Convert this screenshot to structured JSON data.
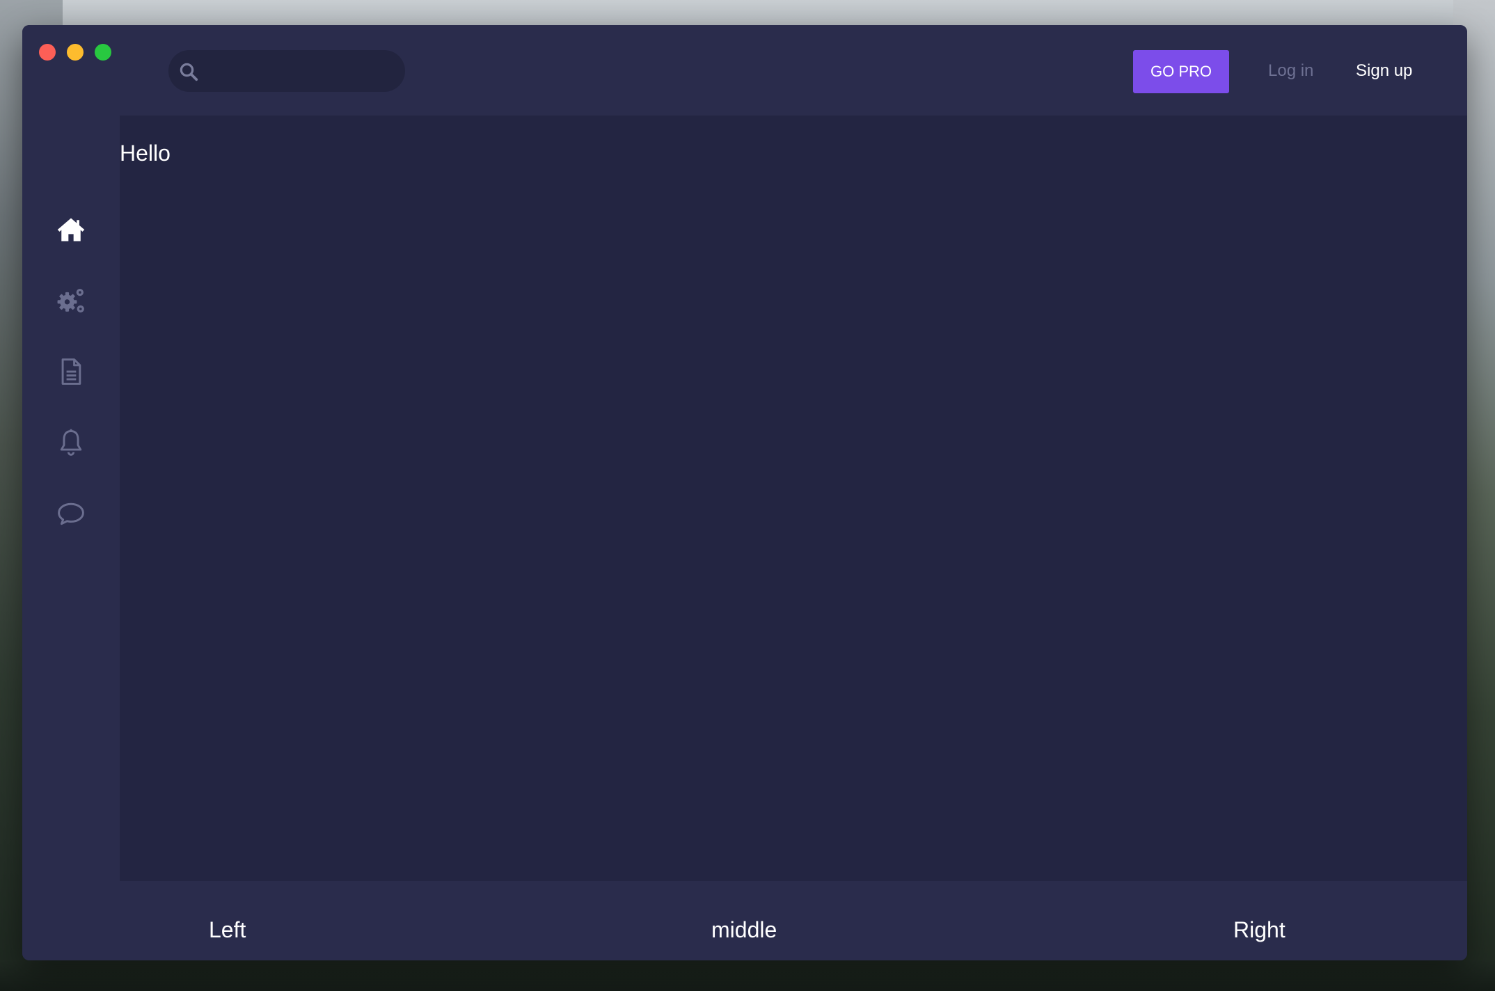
{
  "header": {
    "search": {
      "placeholder": "",
      "value": "",
      "icon": "search-icon"
    },
    "go_pro_label": "GO PRO",
    "login_label": "Log in",
    "signup_label": "Sign up"
  },
  "sidebar": {
    "items": [
      {
        "icon": "home-icon",
        "active": true
      },
      {
        "icon": "gears-icon",
        "active": false
      },
      {
        "icon": "document-icon",
        "active": false
      },
      {
        "icon": "bell-icon",
        "active": false
      },
      {
        "icon": "chat-bubble-icon",
        "active": false
      }
    ]
  },
  "main": {
    "heading": "Hello"
  },
  "footer": {
    "left": "Left",
    "middle": "middle",
    "right": "Right"
  },
  "colors": {
    "accent": "#7c4dea",
    "window_bg": "#232542",
    "panel_bg": "#2a2c4c",
    "muted_text": "#6e7193",
    "icon_inactive": "#6b6e8f"
  }
}
